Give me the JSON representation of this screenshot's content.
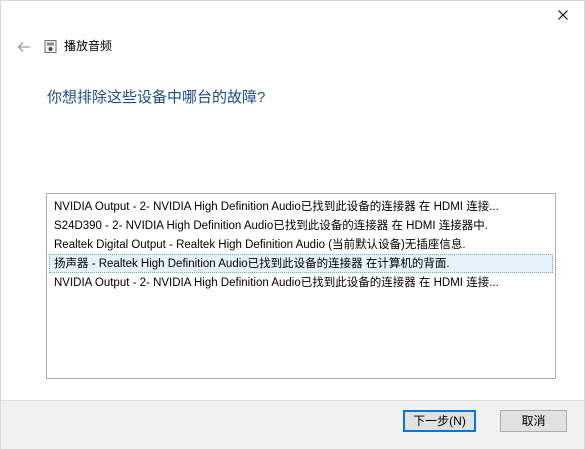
{
  "window": {
    "close_icon": "close-icon",
    "back_icon": "back-arrow-icon"
  },
  "header": {
    "app_icon": "speaker-icon",
    "title": "播放音频"
  },
  "main": {
    "question": "你想排除这些设备中哪台的故障?",
    "devices": [
      "NVIDIA Output - 2- NVIDIA High Definition Audio已找到此设备的连接器 在 HDMI 连接...",
      "S24D390 - 2- NVIDIA High Definition Audio已找到此设备的连接器 在 HDMI 连接器中.",
      "Realtek Digital Output - Realtek High Definition Audio (当前默认设备)无插座信息.",
      "扬声器 - Realtek High Definition Audio已找到此设备的连接器 在计算机的背面.",
      "NVIDIA Output - 2- NVIDIA High Definition Audio已找到此设备的连接器 在 HDMI 连接..."
    ],
    "selected_index": 3
  },
  "footer": {
    "next_label": "下一步(N)",
    "cancel_label": "取消"
  },
  "colors": {
    "accent": "#0078d7",
    "question_text": "#1d4c82",
    "selection_bg": "#e5f1fb",
    "footer_bg": "#f0f0f0"
  }
}
